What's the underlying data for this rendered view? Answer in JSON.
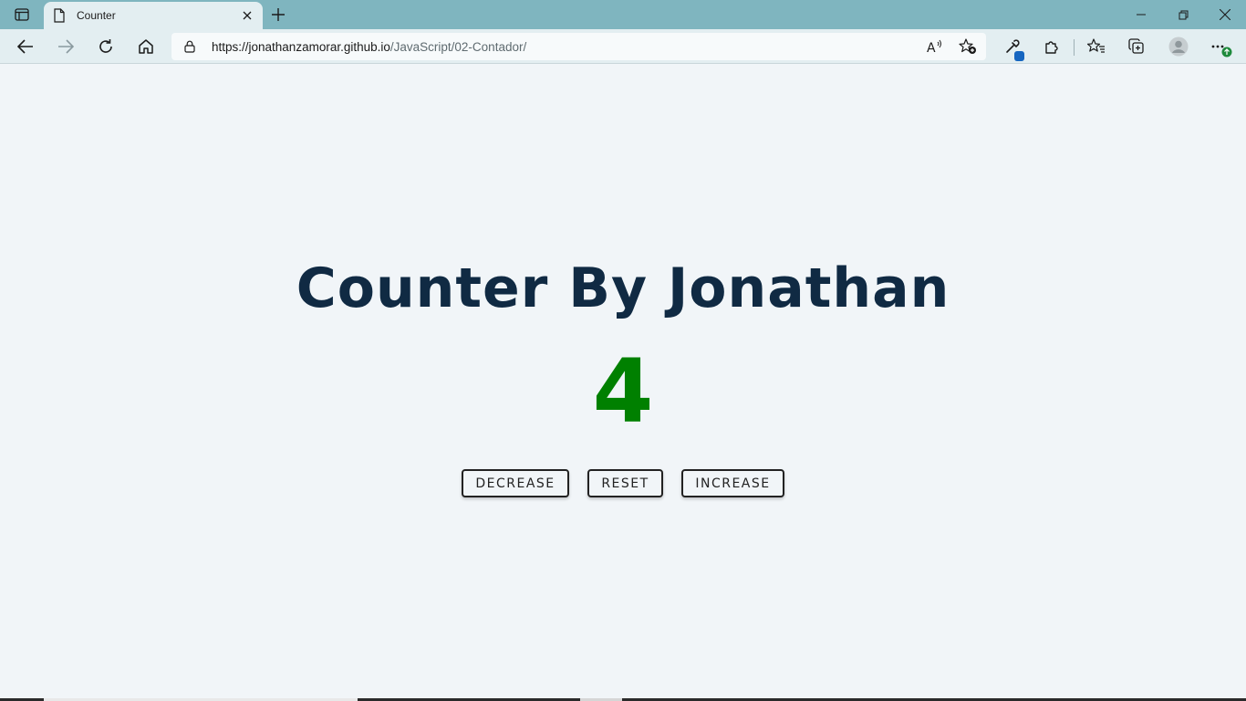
{
  "browser": {
    "tab_title": "Counter",
    "url_host": "https://jonathanzamorar.github.io",
    "url_path": "/JavaScript/02-Contador/"
  },
  "page": {
    "title": "Counter By Jonathan",
    "value": "4",
    "value_color": "#008000",
    "buttons": {
      "decrease": "DECREASE",
      "reset": "RESET",
      "increase": "INCREASE"
    }
  }
}
